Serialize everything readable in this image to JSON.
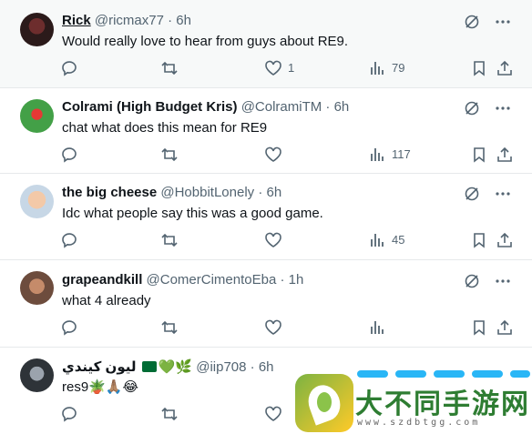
{
  "tweets": [
    {
      "name": "Rick",
      "handle": "@ricmax77",
      "time": "6h",
      "text": "Would really love to hear from guys about RE9.",
      "likes": "1",
      "views": "79"
    },
    {
      "name": "Colrami (High Budget Kris)",
      "handle": "@ColramiTM",
      "time": "6h",
      "text": "chat what does this mean for RE9",
      "likes": "",
      "views": "117"
    },
    {
      "name": "the big cheese",
      "handle": "@HobbitLonely",
      "time": "6h",
      "text": "Idc what people say this was a good game.",
      "likes": "",
      "views": "45"
    },
    {
      "name": "grapeandkill",
      "handle": "@ComerCimentoEba",
      "time": "1h",
      "text": "what 4 already",
      "likes": "",
      "views": ""
    },
    {
      "name": "ليون كيندي",
      "name_emoji": "💚🌿",
      "handle": "@iip708",
      "time": "6h",
      "text": "res9",
      "text_emoji": "🪴🙏🏽😂",
      "likes": "",
      "views": ""
    }
  ],
  "separator": " · ",
  "watermark": {
    "text": "大不同手游网",
    "url": "www.szdbtgg.com"
  },
  "colors": {
    "name": "#0f1419",
    "muted": "#536471",
    "accent_bg": "#f7f9f9"
  }
}
